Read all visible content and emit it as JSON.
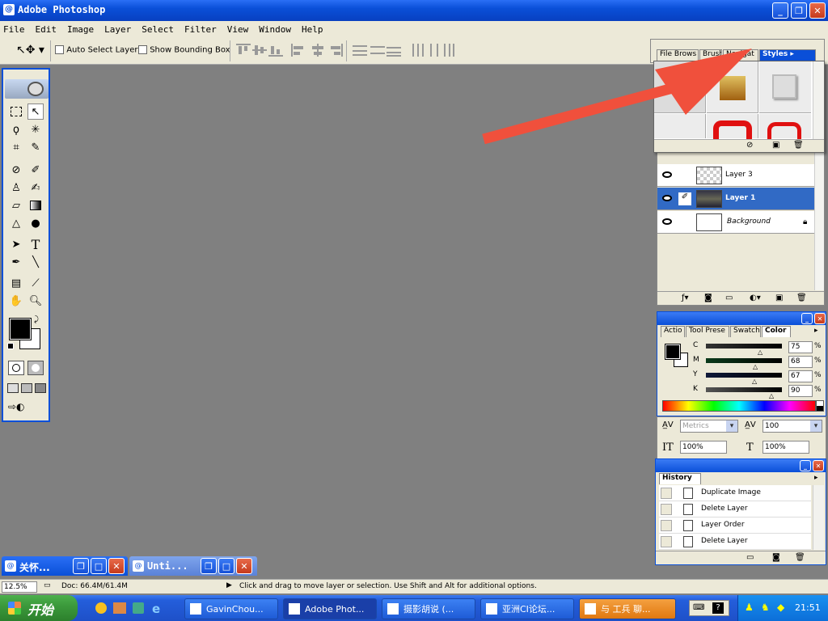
{
  "window": {
    "title": "Adobe Photoshop"
  },
  "menu": [
    "File",
    "Edit",
    "Image",
    "Layer",
    "Select",
    "Filter",
    "View",
    "Window",
    "Help"
  ],
  "options": {
    "auto_select": "Auto Select Layer",
    "show_bounding": "Show Bounding Box"
  },
  "styles_panel": {
    "tabs": [
      "File Brows",
      "Brush",
      "Navigat",
      "Styles"
    ]
  },
  "layers": [
    {
      "name": "Layer 3"
    },
    {
      "name": "Layer 1"
    },
    {
      "name": "Background"
    }
  ],
  "color_panel": {
    "tabs": [
      "Actio",
      "Tool Prese",
      "Swatch",
      "Color"
    ],
    "channels": [
      {
        "label": "C",
        "value": "75"
      },
      {
        "label": "M",
        "value": "68"
      },
      {
        "label": "Y",
        "value": "67"
      },
      {
        "label": "K",
        "value": "90"
      }
    ],
    "pct": "%"
  },
  "character": {
    "kerning": "Metrics",
    "tracking": "100",
    "vscale": "100%",
    "hscale": "100%"
  },
  "history": {
    "tab": "History",
    "items": [
      "Duplicate Image",
      "Delete Layer",
      "Layer Order",
      "Delete Layer"
    ]
  },
  "minimized": [
    {
      "title": "关怀..."
    },
    {
      "title": "Unti..."
    }
  ],
  "status": {
    "zoom": "12.5%",
    "doc": "Doc: 66.4M/61.4M",
    "hint": "Click and drag to move layer or selection.  Use Shift and Alt for additional options."
  },
  "taskbar": {
    "start": "开始",
    "items": [
      "GavinChou...",
      "Adobe Phot...",
      "摄影胡说 (...",
      "亚洲CI论坛...",
      "与 工兵 聊..."
    ],
    "clock": "21:51"
  },
  "colors": {
    "xp_blue": "#0a4fd8",
    "taskbar": "#245edb",
    "start_green": "#3c9a3c",
    "arrow": "#f0503c",
    "selected_layer": "#316ac5"
  }
}
